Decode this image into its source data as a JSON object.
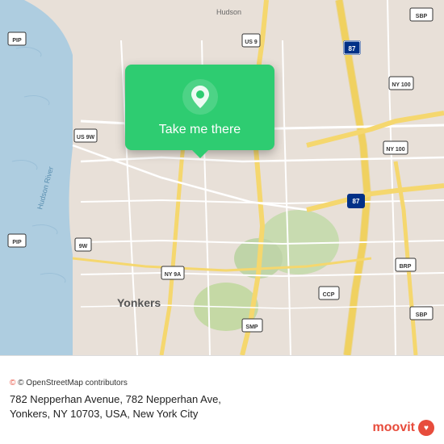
{
  "map": {
    "alt": "Map showing Yonkers, NY area near Hudson River",
    "background_color": "#e8e0d8"
  },
  "popup": {
    "button_label": "Take me there",
    "pin_icon": "location-pin-icon"
  },
  "bottom_bar": {
    "osm_credit": "© OpenStreetMap contributors",
    "address": "782 Nepperhan Avenue, 782 Nepperhan Ave,\nYonkers, NY 10703, USA, New York City",
    "address_line1": "782 Nepperhan Avenue, 782 Nepperhan Ave,",
    "address_line2": "Yonkers, NY 10703, USA, New York City"
  },
  "moovit": {
    "brand_name": "moovit"
  }
}
